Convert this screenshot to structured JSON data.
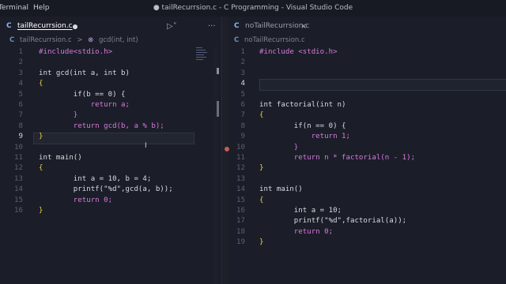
{
  "window": {
    "menu": [
      "Terminal",
      "Help"
    ],
    "title": "● tailRecurrsion.c - C Programming - Visual Studio Code"
  },
  "left": {
    "tab": {
      "lang": "C",
      "label": "tailRecurrsion.c"
    },
    "breadcrumb": {
      "lang": "C",
      "file": "tailRecurrsion.c",
      "separator": ">",
      "symbol": "gcd(int, int)"
    },
    "line_numbers": [
      "1",
      "2",
      "3",
      "4",
      "5",
      "6",
      "7",
      "8",
      "9",
      "10",
      "11",
      "12",
      "13",
      "14",
      "15",
      "16"
    ],
    "code": [
      "#include<stdio.h>",
      "",
      "int gcd(int a, int b)",
      "{",
      "        if(b == 0) {",
      "            return a;",
      "        }",
      "        return gcd(b, a % b);",
      "}",
      "",
      "int main()",
      "{",
      "        int a = 10, b = 4;",
      "        printf(\"%d\",gcd(a, b));",
      "        return 0;",
      "}"
    ]
  },
  "right": {
    "tab": {
      "lang": "C",
      "label": "noTailRecurrsion.c",
      "close": "×"
    },
    "breadcrumb": {
      "lang": "C",
      "file": "noTailRecurrsion.c"
    },
    "line_numbers": [
      "1",
      "2",
      "3",
      "4",
      "5",
      "6",
      "7",
      "8",
      "9",
      "10",
      "11",
      "12",
      "13",
      "14",
      "15",
      "16",
      "17",
      "18",
      "19"
    ],
    "code": [
      "#include <stdio.h>",
      "",
      "",
      "",
      "",
      "int factorial(int n)",
      "{",
      "        if(n == 0) {",
      "            return 1;",
      "        }",
      "        return n * factorial(n - 1);",
      "}",
      "",
      "int main()",
      "{",
      "        int a = 10;",
      "        printf(\"%d\",factorial(a));",
      "        return 0;",
      "}"
    ]
  },
  "icons": {
    "run": "run-icon",
    "more": "more-actions-icon",
    "language": "c-language-icon",
    "symbol": "symbol-icon"
  },
  "colors": {
    "background": "#1b1e28",
    "keyword": "#d57bdc",
    "type": "#7ea7ff",
    "string": "#a6ef9a",
    "number": "#ffb86c"
  }
}
